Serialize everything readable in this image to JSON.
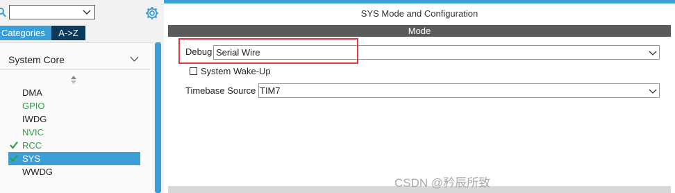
{
  "left": {
    "search": {
      "value": ""
    },
    "tabs": [
      {
        "label": "Categories",
        "active": true
      },
      {
        "label": "A->Z",
        "active": false
      }
    ],
    "section": {
      "label": "System Core"
    },
    "peripherals": [
      {
        "label": "DMA",
        "color": "#222222",
        "checked": false,
        "selected": false
      },
      {
        "label": "GPIO",
        "color": "#2e9f48",
        "checked": false,
        "selected": false
      },
      {
        "label": "IWDG",
        "color": "#222222",
        "checked": false,
        "selected": false
      },
      {
        "label": "NVIC",
        "color": "#2e9f48",
        "checked": false,
        "selected": false
      },
      {
        "label": "RCC",
        "color": "#2e9f48",
        "checked": true,
        "selected": false
      },
      {
        "label": "SYS",
        "color": "#ffffff",
        "checked": true,
        "selected": true
      },
      {
        "label": "WWDG",
        "color": "#222222",
        "checked": false,
        "selected": false
      }
    ]
  },
  "main": {
    "title": "SYS Mode and Configuration",
    "mode_header": "Mode",
    "debug": {
      "label": "Debug",
      "value": "Serial Wire"
    },
    "system_wakeup": {
      "label": "System Wake-Up",
      "checked": false
    },
    "timebase": {
      "label": "Timebase Source",
      "value": "TIM7"
    }
  },
  "watermark": "CSDN @矜辰所致",
  "colors": {
    "accent": "#3b9ed6",
    "tab_dark": "#0c3a5a",
    "mode_bar": "#5b5b5b",
    "highlight": "#e8343b",
    "active_green": "#2e9f48"
  }
}
